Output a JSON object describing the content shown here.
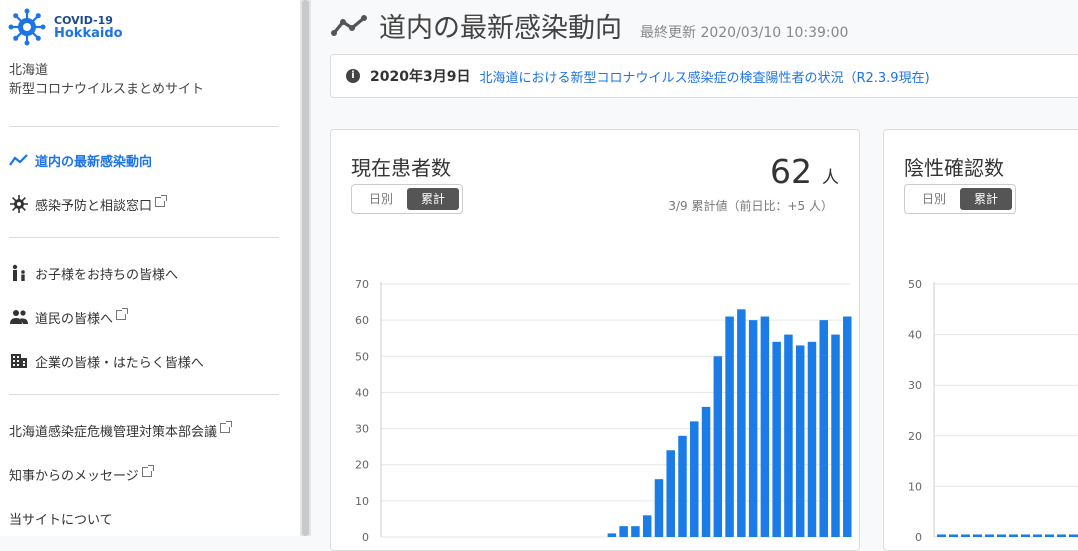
{
  "logo": {
    "line1": "COVID-19",
    "line2": "Hokkaido"
  },
  "site": {
    "line1": "北海道",
    "line2": "新型コロナウイルスまとめサイト"
  },
  "nav": [
    {
      "label": "道内の最新感染動向",
      "icon": "trend-icon"
    },
    {
      "label": "感染予防と相談窓口",
      "icon": "virus-icon"
    },
    {
      "label": "お子様をお持ちの皆様へ",
      "icon": "parent-child-icon"
    },
    {
      "label": "道民の皆様へ",
      "icon": "people-icon"
    },
    {
      "label": "企業の皆様・はたらく皆様へ",
      "icon": "building-icon"
    },
    {
      "label": "北海道感染症危機管理対策本部会議"
    },
    {
      "label": "知事からのメッセージ"
    },
    {
      "label": "当サイトについて"
    }
  ],
  "header": {
    "title": "道内の最新感染動向",
    "updated": "最終更新 2020/03/10 10:39:00"
  },
  "notice": {
    "date": "2020年3月9日",
    "link": "北海道における新型コロナウイルス感染症の検査陽性者の状況（R2.3.9現在)"
  },
  "cards": {
    "patients": {
      "title": "現在患者数",
      "toggle_daily": "日別",
      "toggle_cumulative": "累計",
      "value": "62",
      "unit": "人",
      "note": "3/9 累計値（前日比：+5 人）"
    },
    "negative": {
      "title": "陰性確認数",
      "toggle_daily": "日別",
      "toggle_cumulative": "累計"
    }
  },
  "colors": {
    "accent": "#1d74e8",
    "bar": "#1b7ce8"
  },
  "chart_data": [
    {
      "type": "bar",
      "ylim": [
        0,
        70
      ],
      "yticks": [
        0,
        10,
        20,
        30,
        40,
        50,
        60,
        70
      ],
      "values": [
        0,
        0,
        0,
        0,
        0,
        0,
        0,
        0,
        0,
        0,
        0,
        0,
        0,
        0,
        0,
        0,
        0,
        0,
        0,
        1,
        3,
        3,
        6,
        16,
        24,
        28,
        32,
        36,
        50,
        61,
        63,
        60,
        61,
        54,
        56,
        53,
        54,
        60,
        56,
        61
      ]
    },
    {
      "type": "bar",
      "ylim": [
        0,
        50
      ],
      "yticks": [
        0,
        10,
        20,
        30,
        40,
        50
      ],
      "values": [
        0.5,
        0.5,
        0.5,
        0.5,
        0.5,
        0.5,
        0.5,
        0.5,
        0.5,
        0.5,
        0.5,
        0.5,
        0.5
      ]
    }
  ]
}
